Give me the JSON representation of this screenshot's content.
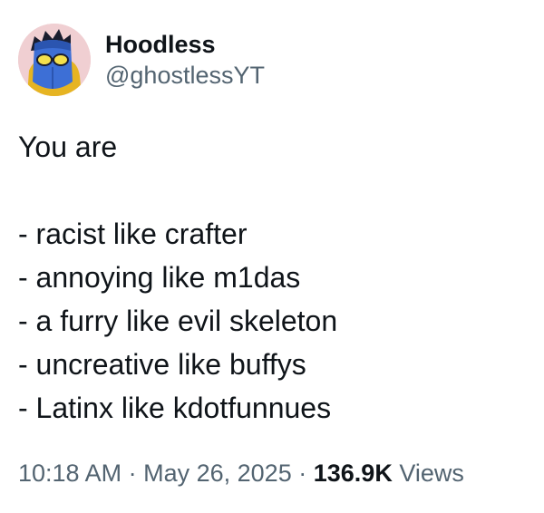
{
  "author": {
    "display_name": "Hoodless",
    "handle": "@ghostlessYT",
    "avatar_icon": "masked-hooded-character-avatar",
    "avatar_bg": "#f0cfd2"
  },
  "tweet": {
    "lines": [
      "You are",
      "",
      "- racist like crafter",
      "- annoying like m1das",
      "- a furry like evil skeleton",
      "- uncreative like buffys",
      "- Latinx like kdotfunnues"
    ]
  },
  "meta": {
    "time": "10:18 AM",
    "separator": "·",
    "date": "May 26, 2025",
    "views_count": "136.9K",
    "views_label": "Views"
  },
  "colors": {
    "text_primary": "#0f1419",
    "text_secondary": "#536471"
  }
}
